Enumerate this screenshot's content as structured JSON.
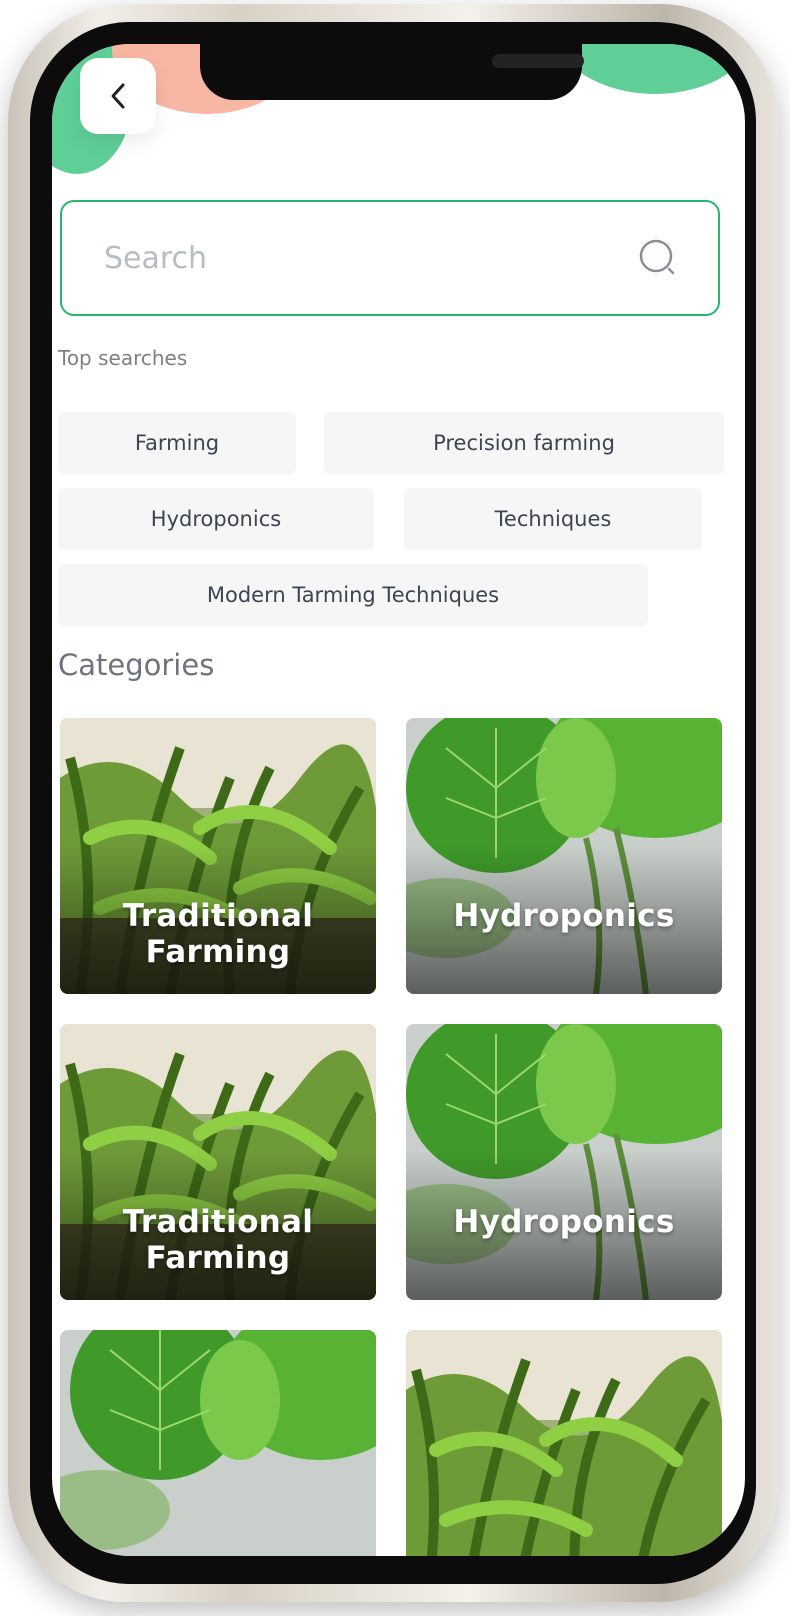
{
  "header": {
    "back_icon": "chevron-left-icon"
  },
  "search": {
    "placeholder": "Search",
    "icon": "search-icon",
    "border_color": "#27b66e"
  },
  "top_searches": {
    "label": "Top searches",
    "chips": [
      "Farming",
      "Precision farming",
      "Hydroponics",
      "Techniques",
      "Modern Tarming Techniques"
    ]
  },
  "categories": {
    "label": "Categories",
    "cards": [
      {
        "label": "Traditional Farming",
        "image": "corn-field-photo"
      },
      {
        "label": "Hydroponics",
        "image": "strawberry-leaf-photo"
      },
      {
        "label": "Traditional Farming",
        "image": "corn-field-photo"
      },
      {
        "label": "Hydroponics",
        "image": "strawberry-leaf-photo"
      },
      {
        "label": "",
        "image": "strawberry-leaf-photo"
      },
      {
        "label": "",
        "image": "corn-field-photo"
      }
    ]
  },
  "colors": {
    "accent_green": "#5fcf97",
    "accent_peach": "#f7b7a3"
  }
}
